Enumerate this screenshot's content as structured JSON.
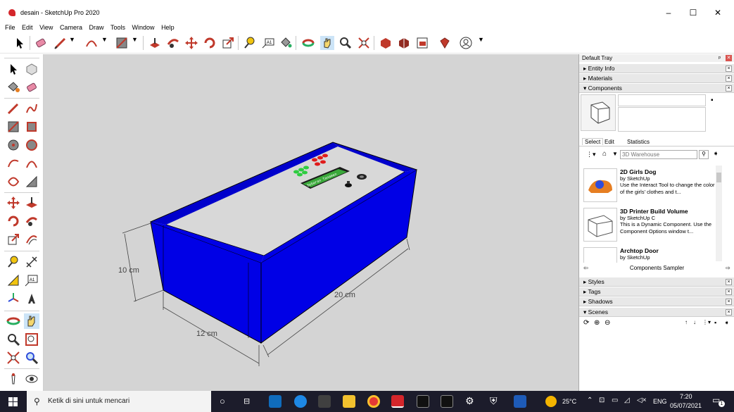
{
  "window": {
    "title": "desain - SketchUp Pro 2020"
  },
  "menu": [
    "File",
    "Edit",
    "View",
    "Camera",
    "Draw",
    "Tools",
    "Window",
    "Help"
  ],
  "viewport": {
    "dimensions": {
      "height": "10 cm",
      "width": "12 cm",
      "length": "20 cm"
    },
    "box_color": "#0000e6",
    "top_color": "#d8d8d8",
    "display_text": "Sebaran Tanaman"
  },
  "tray": {
    "title": "Default Tray",
    "sections_top": [
      {
        "label": "Entity Info",
        "expanded": false
      },
      {
        "label": "Materials",
        "expanded": false
      },
      {
        "label": "Components",
        "expanded": true
      }
    ],
    "tabs": [
      "Select",
      "Edit",
      "Statistics"
    ],
    "search_placeholder": "3D Warehouse",
    "components": [
      {
        "title": "2D Girls Dog",
        "by": "by SketchUp",
        "desc": "Use the Interact Tool to change the color of the girls' clothes and t..."
      },
      {
        "title": "3D Printer Build Volume",
        "by": "by SketchUp C",
        "desc": "This is a Dynamic Component. Use the Component Options window t..."
      },
      {
        "title": "Archtop Door",
        "by": "by SketchUp",
        "desc": ""
      }
    ],
    "sampler_label": "Components Sampler",
    "sections_bottom": [
      {
        "label": "Styles",
        "expanded": false
      },
      {
        "label": "Tags",
        "expanded": false
      },
      {
        "label": "Shadows",
        "expanded": false
      },
      {
        "label": "Scenes",
        "expanded": true
      }
    ]
  },
  "taskbar": {
    "search_placeholder": "Ketik di sini untuk mencari",
    "temperature": "25°C",
    "language": "ENG",
    "time": "7:20",
    "date": "05/07/2021",
    "notification_count": "1"
  }
}
